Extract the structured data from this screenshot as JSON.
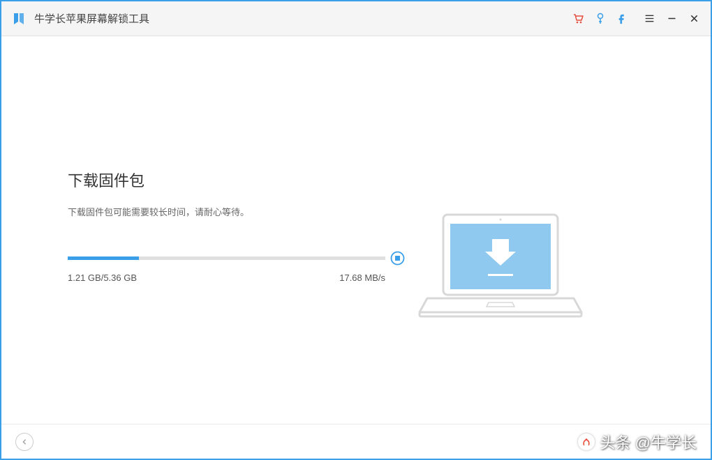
{
  "app": {
    "title": "牛学长苹果屏幕解锁工具"
  },
  "colors": {
    "accent": "#3a9fe8",
    "red": "#e74c3c"
  },
  "main": {
    "heading": "下载固件包",
    "subtext": "下载固件包可能需要较长时间，请耐心等待。",
    "progress": {
      "percent": 22.5,
      "downloaded": "1.21 GB",
      "total": "5.36 GB",
      "speed": "17.68 MB/s"
    }
  },
  "watermark": {
    "text": "头条 @牛学长"
  }
}
